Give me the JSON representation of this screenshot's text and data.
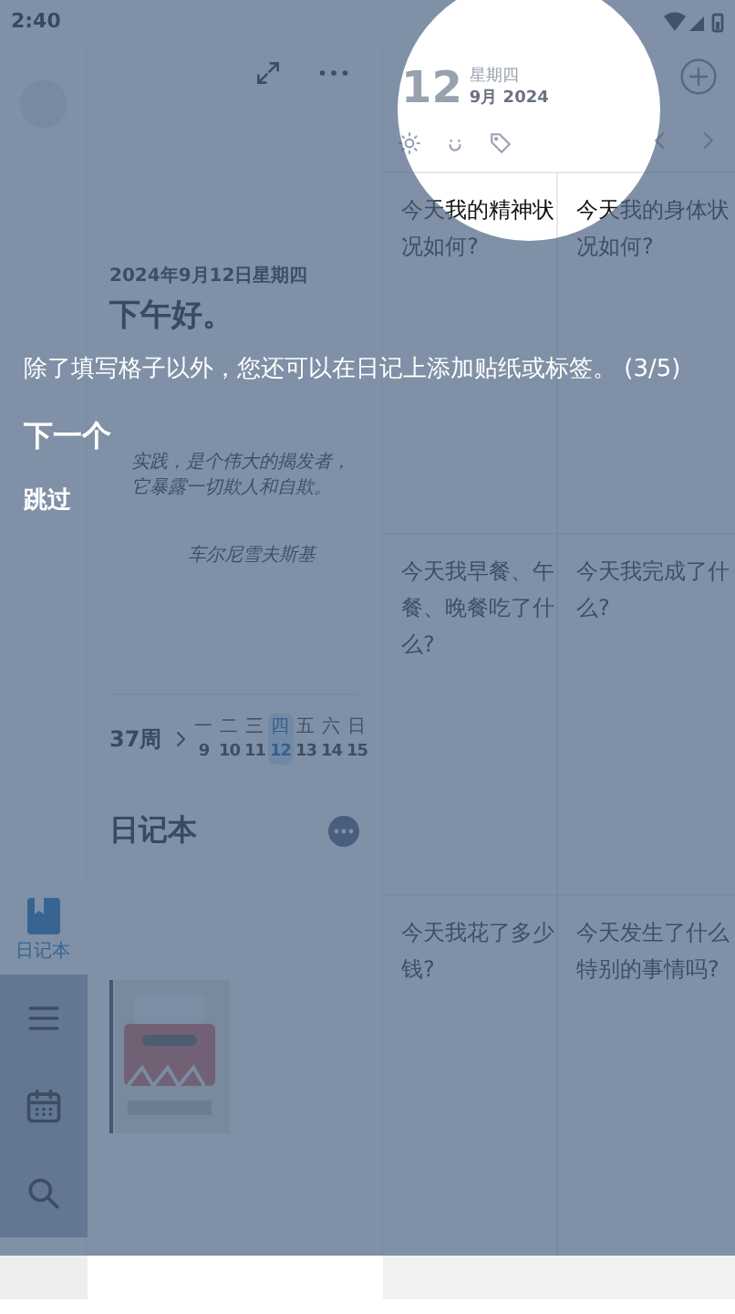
{
  "status_bar": {
    "time": "2:40"
  },
  "rail": {
    "items": [
      {
        "kind": "diary",
        "label": "日记本",
        "selected": true
      },
      {
        "kind": "menu",
        "selected": false
      },
      {
        "kind": "calendar",
        "selected": false
      },
      {
        "kind": "search",
        "selected": false
      }
    ]
  },
  "today": {
    "date": "2024年9月12日星期四",
    "greeting": "下午好。",
    "quote": "实践，是个伟大的揭发者，它暴露一切欺人和自欺。",
    "quote_author": "车尔尼雪夫斯基"
  },
  "week": {
    "label": "37周",
    "days": [
      {
        "weekday": "一",
        "date": "9",
        "selected": false
      },
      {
        "weekday": "二",
        "date": "10",
        "selected": false
      },
      {
        "weekday": "三",
        "date": "11",
        "selected": false
      },
      {
        "weekday": "四",
        "date": "12",
        "selected": true
      },
      {
        "weekday": "五",
        "date": "13",
        "selected": false
      },
      {
        "weekday": "六",
        "date": "14",
        "selected": false
      },
      {
        "weekday": "日",
        "date": "15",
        "selected": false
      }
    ]
  },
  "diary": {
    "title": "日记本"
  },
  "entry": {
    "day": "12",
    "weekday": "星期四",
    "month_year": "9月 2024",
    "prompts": [
      "今天我的精神状况如何?",
      "今天我的身体状况如何?",
      "今天我早餐、午餐、晚餐吃了什么?",
      "今天我完成了什么?",
      "今天我花了多少钱?",
      "今天发生了什么特别的事情吗?"
    ]
  },
  "tutorial": {
    "message": "除了填写格子以外，您还可以在日记上添加贴纸或标签。 (3/5)",
    "next": "下一个",
    "skip": "跳过"
  }
}
